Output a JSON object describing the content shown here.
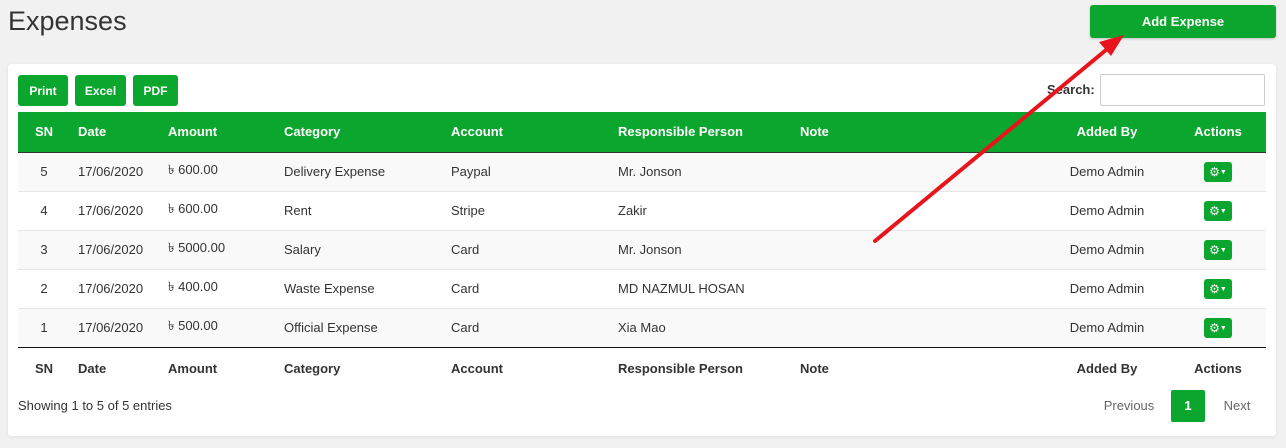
{
  "page": {
    "title": "Expenses",
    "add_label": "Add Expense"
  },
  "toolbar": {
    "print": "Print",
    "excel": "Excel",
    "pdf": "PDF"
  },
  "search": {
    "label": "Search:",
    "value": ""
  },
  "columns": [
    "SN",
    "Date",
    "Amount",
    "Category",
    "Account",
    "Responsible Person",
    "Note",
    "Added By",
    "Actions"
  ],
  "rows": [
    {
      "sn": "5",
      "date": "17/06/2020",
      "amount": "৳ 600.00",
      "category": "Delivery Expense",
      "account": "Paypal",
      "person": "Mr. Jonson",
      "note": "",
      "added_by": "Demo Admin"
    },
    {
      "sn": "4",
      "date": "17/06/2020",
      "amount": "৳ 600.00",
      "category": "Rent",
      "account": "Stripe",
      "person": "Zakir",
      "note": "",
      "added_by": "Demo Admin"
    },
    {
      "sn": "3",
      "date": "17/06/2020",
      "amount": "৳ 5000.00",
      "category": "Salary",
      "account": "Card",
      "person": "Mr. Jonson",
      "note": "",
      "added_by": "Demo Admin"
    },
    {
      "sn": "2",
      "date": "17/06/2020",
      "amount": "৳ 400.00",
      "category": "Waste Expense",
      "account": "Card",
      "person": "MD NAZMUL HOSAN",
      "note": "",
      "added_by": "Demo Admin"
    },
    {
      "sn": "1",
      "date": "17/06/2020",
      "amount": "৳ 500.00",
      "category": "Official Expense",
      "account": "Card",
      "person": "Xia Mao",
      "note": "",
      "added_by": "Demo Admin"
    }
  ],
  "footer": {
    "info": "Showing 1 to 5 of 5 entries"
  },
  "pagination": {
    "previous": "Previous",
    "current": "1",
    "next": "Next"
  },
  "icons": {
    "action": "gear-icon",
    "caret": "caret-down-icon",
    "annotation": "red-arrow"
  },
  "colors": {
    "accent": "#0aa62d",
    "annotation": "#e8141b"
  }
}
